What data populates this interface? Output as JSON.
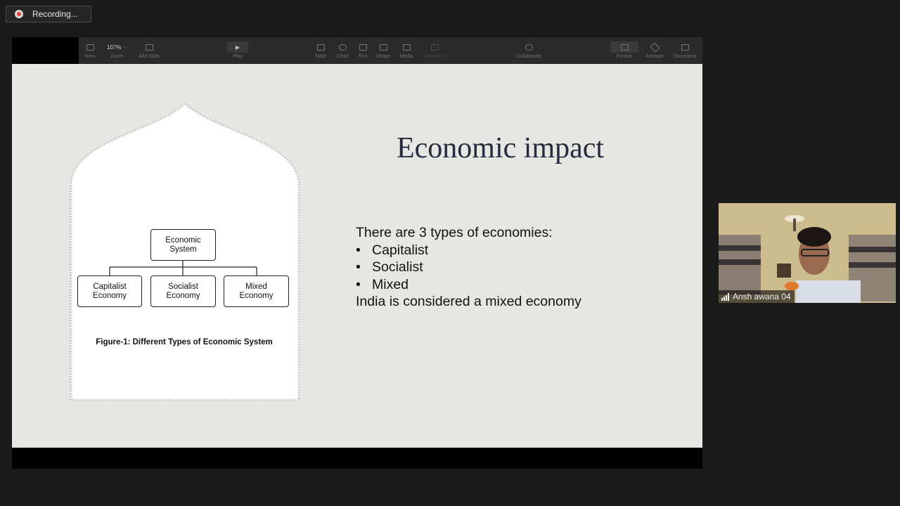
{
  "recording": {
    "label": "Recording..."
  },
  "toolbar": {
    "view": "View",
    "zoom_value": "107%",
    "zoom": "Zoom",
    "add_slide": "Add Slide",
    "play": "Play",
    "table": "Table",
    "chart": "Chart",
    "text": "Text",
    "shape": "Shape",
    "media": "Media",
    "comment": "Comment",
    "collaborate": "Collaborate",
    "format": "Format",
    "animate": "Animate",
    "document": "Document"
  },
  "slide": {
    "title": "Economic impact",
    "intro": "There  are 3 types of economies:",
    "bullets": [
      "Capitalist",
      "Socialist",
      "Mixed"
    ],
    "conclusion": "India is considered a mixed economy",
    "bullet_symbol": "•",
    "figure": {
      "root_line1": "Economic",
      "root_line2": "System",
      "children": [
        {
          "line1": "Capitalist",
          "line2": "Economy"
        },
        {
          "line1": "Socialist",
          "line2": "Economy"
        },
        {
          "line1": "Mixed",
          "line2": "Economy"
        }
      ],
      "caption": "Figure-1: Different Types of Economic System"
    }
  },
  "participant": {
    "name": "Ansh awana 04"
  },
  "colors": {
    "background": "#1a1a1a",
    "slide_background": "#e6e7e2",
    "title_color": "#262b3e",
    "recording_dot": "#e0413b"
  }
}
